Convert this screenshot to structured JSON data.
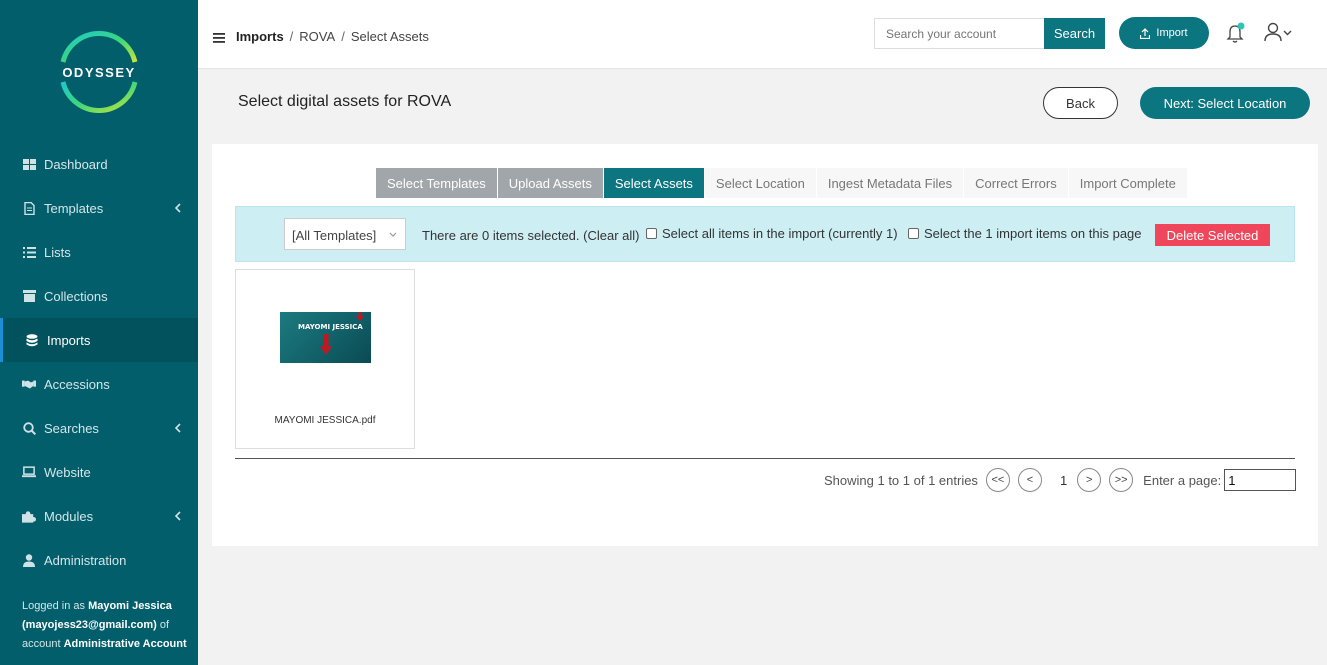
{
  "brand": {
    "name": "ODYSSEY"
  },
  "sidebar": {
    "items": [
      {
        "label": "Dashboard",
        "icon": "dashboard-icon"
      },
      {
        "label": "Templates",
        "icon": "document-icon"
      },
      {
        "label": "Lists",
        "icon": "list-icon"
      },
      {
        "label": "Collections",
        "icon": "archive-icon"
      },
      {
        "label": "Imports",
        "icon": "database-icon"
      },
      {
        "label": "Accessions",
        "icon": "handshake-icon"
      },
      {
        "label": "Searches",
        "icon": "search-icon"
      },
      {
        "label": "Website",
        "icon": "laptop-icon"
      },
      {
        "label": "Modules",
        "icon": "puzzle-icon"
      },
      {
        "label": "Administration",
        "icon": "user-icon"
      }
    ],
    "active": "Imports",
    "login": {
      "prefix": "Logged in as",
      "name": "Mayomi Jessica",
      "email": "(mayojess23@gmail.com)",
      "of_account": "of account",
      "account": "Administrative Account"
    }
  },
  "header": {
    "breadcrumb": [
      "Imports",
      "ROVA",
      "Select Assets"
    ],
    "search_placeholder": "Search your account",
    "search_label": "Search",
    "import_label": "Import"
  },
  "page": {
    "title": "Select digital assets for ROVA",
    "back_label": "Back",
    "next_label": "Next: Select Location"
  },
  "steps": [
    {
      "label": "Select Templates",
      "state": "done"
    },
    {
      "label": "Upload Assets",
      "state": "done"
    },
    {
      "label": "Select Assets",
      "state": "current"
    },
    {
      "label": "Select Location",
      "state": "todo"
    },
    {
      "label": "Ingest Metadata Files",
      "state": "todo"
    },
    {
      "label": "Correct Errors",
      "state": "todo"
    },
    {
      "label": "Import Complete",
      "state": "todo"
    }
  ],
  "filter": {
    "template_value": "[All Templates]",
    "selected_text": "There are 0 items selected. (Clear all)",
    "select_all_label": "Select all items in the import (currently 1)",
    "select_page_label": "Select the 1 import items on this page",
    "delete_label": "Delete Selected"
  },
  "assets": [
    {
      "name": "MAYOMI JESSICA.pdf",
      "thumb_text": "MAYOMI JESSICA"
    }
  ],
  "pager": {
    "showing": "Showing 1 to 1 of 1 entries",
    "first": "<<",
    "prev": "<",
    "current": "1",
    "next": ">",
    "last": ">>",
    "enter_label": "Enter a page:",
    "page_value": "1"
  },
  "colors": {
    "sidebar": "#035e6b",
    "accent": "#0b7580",
    "danger": "#f0465b",
    "filter_bg": "#cdeff4"
  }
}
